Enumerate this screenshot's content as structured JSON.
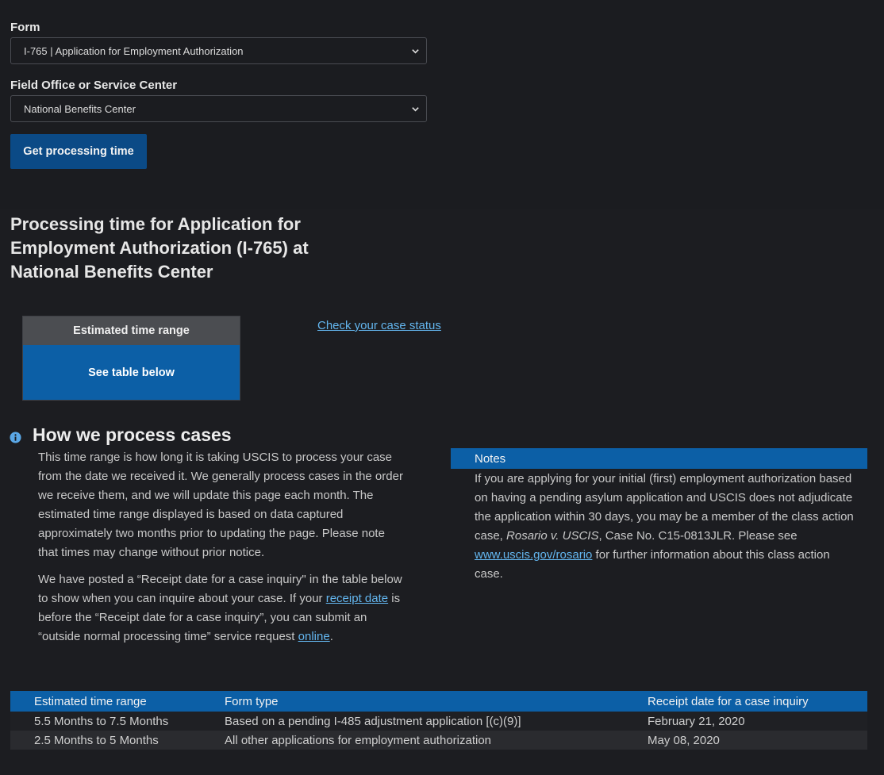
{
  "form_field": {
    "label": "Form",
    "selected": "I-765 | Application for Employment Authorization"
  },
  "office_field": {
    "label": "Field Office or Service Center",
    "selected": "National Benefits Center"
  },
  "submit_button": {
    "label": "Get processing time"
  },
  "results": {
    "title": "Processing time for Application for Employment Authorization (I-765) at National Benefits Center",
    "range_box": {
      "heading": "Estimated time range",
      "value": "See table below"
    },
    "check_status_link": "Check your case status"
  },
  "how": {
    "title": "How we process cases",
    "para1": "This time range is how long it is taking USCIS to process your case from the date we received it. We generally process cases in the order we receive them, and we will update this page each month. The estimated time range displayed is based on data captured approximately two months prior to updating the page. Please note that times may change without prior notice.",
    "para2_a": "We have posted a “Receipt date for a case inquiry\" in the table below to show when you can inquire about your case. If your ",
    "para2_link1": "receipt date",
    "para2_b": " is before the “Receipt date for a case inquiry”, you can submit an “outside normal processing time” service request ",
    "para2_link2": "online",
    "para2_c": "."
  },
  "notes": {
    "heading": "Notes",
    "text_a": "If you are applying for your initial (first) employment authorization based on having a pending asylum application and USCIS does not adjudicate the application within 30 days, you may be a member of the class action case, ",
    "case_name": "Rosario v. USCIS",
    "text_b": ", Case No. C15-0813JLR. Please see ",
    "link": "www.uscis.gov/rosario",
    "text_c": " for further information about this class action case."
  },
  "table": {
    "headers": [
      "Estimated time range",
      "Form type",
      "Receipt date for a case inquiry"
    ],
    "rows": [
      [
        "5.5 Months to 7.5 Months",
        "Based on a pending I-485 adjustment application [(c)(9)]",
        "February 21, 2020"
      ],
      [
        "2.5 Months to 5 Months",
        "All other applications for employment authorization",
        "May 08, 2020"
      ]
    ]
  },
  "colors": {
    "background": "#1b1c20",
    "primary_button": "#0b4a86",
    "accent_blue": "#0c5fa6",
    "link": "#63b6ef"
  },
  "icons": [
    "chevron-down-icon",
    "info-icon"
  ]
}
